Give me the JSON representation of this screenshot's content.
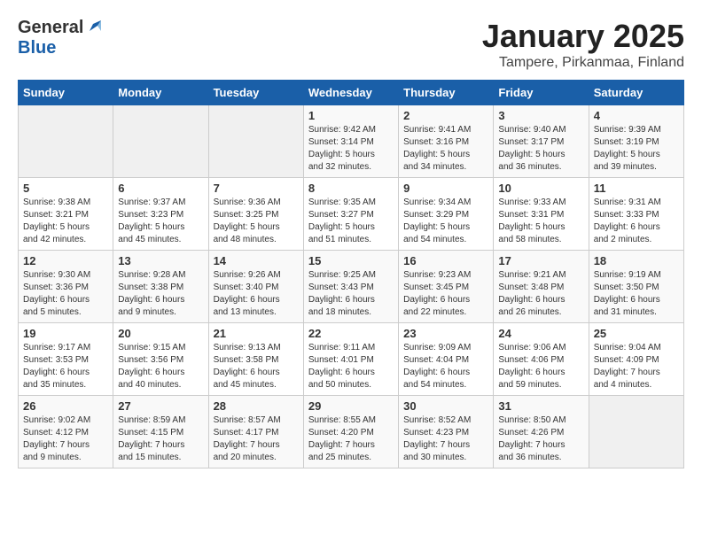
{
  "header": {
    "logo_general": "General",
    "logo_blue": "Blue",
    "title": "January 2025",
    "subtitle": "Tampere, Pirkanmaa, Finland"
  },
  "calendar": {
    "weekdays": [
      "Sunday",
      "Monday",
      "Tuesday",
      "Wednesday",
      "Thursday",
      "Friday",
      "Saturday"
    ],
    "weeks": [
      [
        {
          "day": "",
          "info": ""
        },
        {
          "day": "",
          "info": ""
        },
        {
          "day": "",
          "info": ""
        },
        {
          "day": "1",
          "info": "Sunrise: 9:42 AM\nSunset: 3:14 PM\nDaylight: 5 hours\nand 32 minutes."
        },
        {
          "day": "2",
          "info": "Sunrise: 9:41 AM\nSunset: 3:16 PM\nDaylight: 5 hours\nand 34 minutes."
        },
        {
          "day": "3",
          "info": "Sunrise: 9:40 AM\nSunset: 3:17 PM\nDaylight: 5 hours\nand 36 minutes."
        },
        {
          "day": "4",
          "info": "Sunrise: 9:39 AM\nSunset: 3:19 PM\nDaylight: 5 hours\nand 39 minutes."
        }
      ],
      [
        {
          "day": "5",
          "info": "Sunrise: 9:38 AM\nSunset: 3:21 PM\nDaylight: 5 hours\nand 42 minutes."
        },
        {
          "day": "6",
          "info": "Sunrise: 9:37 AM\nSunset: 3:23 PM\nDaylight: 5 hours\nand 45 minutes."
        },
        {
          "day": "7",
          "info": "Sunrise: 9:36 AM\nSunset: 3:25 PM\nDaylight: 5 hours\nand 48 minutes."
        },
        {
          "day": "8",
          "info": "Sunrise: 9:35 AM\nSunset: 3:27 PM\nDaylight: 5 hours\nand 51 minutes."
        },
        {
          "day": "9",
          "info": "Sunrise: 9:34 AM\nSunset: 3:29 PM\nDaylight: 5 hours\nand 54 minutes."
        },
        {
          "day": "10",
          "info": "Sunrise: 9:33 AM\nSunset: 3:31 PM\nDaylight: 5 hours\nand 58 minutes."
        },
        {
          "day": "11",
          "info": "Sunrise: 9:31 AM\nSunset: 3:33 PM\nDaylight: 6 hours\nand 2 minutes."
        }
      ],
      [
        {
          "day": "12",
          "info": "Sunrise: 9:30 AM\nSunset: 3:36 PM\nDaylight: 6 hours\nand 5 minutes."
        },
        {
          "day": "13",
          "info": "Sunrise: 9:28 AM\nSunset: 3:38 PM\nDaylight: 6 hours\nand 9 minutes."
        },
        {
          "day": "14",
          "info": "Sunrise: 9:26 AM\nSunset: 3:40 PM\nDaylight: 6 hours\nand 13 minutes."
        },
        {
          "day": "15",
          "info": "Sunrise: 9:25 AM\nSunset: 3:43 PM\nDaylight: 6 hours\nand 18 minutes."
        },
        {
          "day": "16",
          "info": "Sunrise: 9:23 AM\nSunset: 3:45 PM\nDaylight: 6 hours\nand 22 minutes."
        },
        {
          "day": "17",
          "info": "Sunrise: 9:21 AM\nSunset: 3:48 PM\nDaylight: 6 hours\nand 26 minutes."
        },
        {
          "day": "18",
          "info": "Sunrise: 9:19 AM\nSunset: 3:50 PM\nDaylight: 6 hours\nand 31 minutes."
        }
      ],
      [
        {
          "day": "19",
          "info": "Sunrise: 9:17 AM\nSunset: 3:53 PM\nDaylight: 6 hours\nand 35 minutes."
        },
        {
          "day": "20",
          "info": "Sunrise: 9:15 AM\nSunset: 3:56 PM\nDaylight: 6 hours\nand 40 minutes."
        },
        {
          "day": "21",
          "info": "Sunrise: 9:13 AM\nSunset: 3:58 PM\nDaylight: 6 hours\nand 45 minutes."
        },
        {
          "day": "22",
          "info": "Sunrise: 9:11 AM\nSunset: 4:01 PM\nDaylight: 6 hours\nand 50 minutes."
        },
        {
          "day": "23",
          "info": "Sunrise: 9:09 AM\nSunset: 4:04 PM\nDaylight: 6 hours\nand 54 minutes."
        },
        {
          "day": "24",
          "info": "Sunrise: 9:06 AM\nSunset: 4:06 PM\nDaylight: 6 hours\nand 59 minutes."
        },
        {
          "day": "25",
          "info": "Sunrise: 9:04 AM\nSunset: 4:09 PM\nDaylight: 7 hours\nand 4 minutes."
        }
      ],
      [
        {
          "day": "26",
          "info": "Sunrise: 9:02 AM\nSunset: 4:12 PM\nDaylight: 7 hours\nand 9 minutes."
        },
        {
          "day": "27",
          "info": "Sunrise: 8:59 AM\nSunset: 4:15 PM\nDaylight: 7 hours\nand 15 minutes."
        },
        {
          "day": "28",
          "info": "Sunrise: 8:57 AM\nSunset: 4:17 PM\nDaylight: 7 hours\nand 20 minutes."
        },
        {
          "day": "29",
          "info": "Sunrise: 8:55 AM\nSunset: 4:20 PM\nDaylight: 7 hours\nand 25 minutes."
        },
        {
          "day": "30",
          "info": "Sunrise: 8:52 AM\nSunset: 4:23 PM\nDaylight: 7 hours\nand 30 minutes."
        },
        {
          "day": "31",
          "info": "Sunrise: 8:50 AM\nSunset: 4:26 PM\nDaylight: 7 hours\nand 36 minutes."
        },
        {
          "day": "",
          "info": ""
        }
      ]
    ]
  }
}
